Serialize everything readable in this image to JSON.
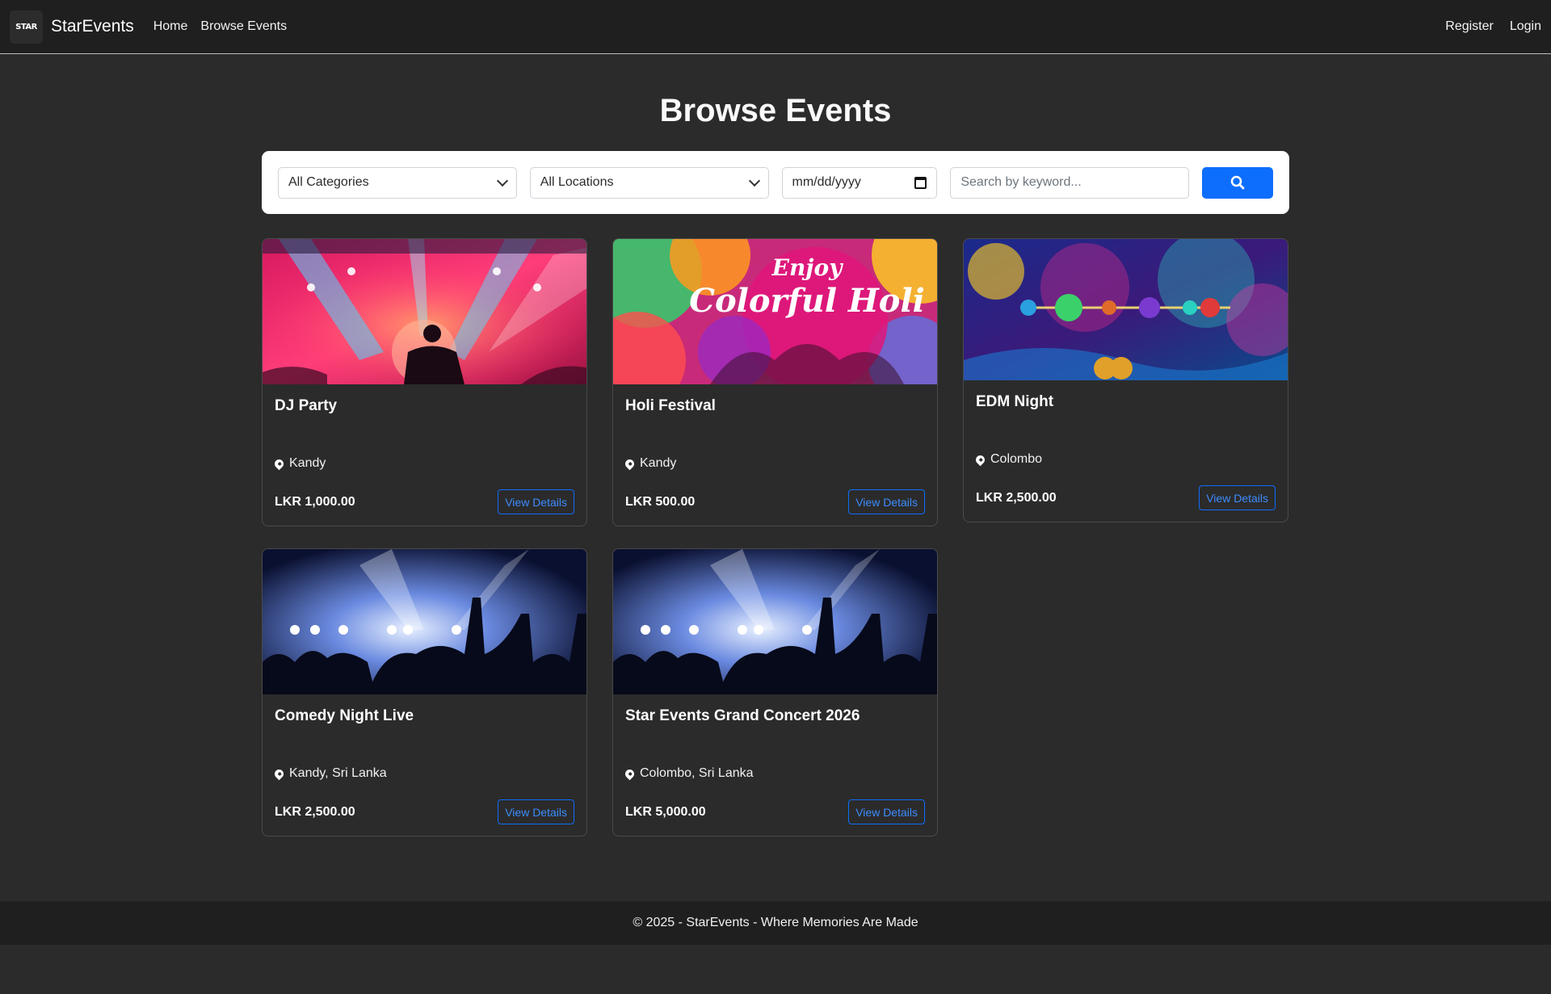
{
  "nav": {
    "brand": "StarEvents",
    "logo_text": "STAR",
    "links": [
      "Home",
      "Browse Events"
    ],
    "register": "Register",
    "login": "Login"
  },
  "page": {
    "title": "Browse Events"
  },
  "filters": {
    "category": "All Categories",
    "location": "All Locations",
    "date_placeholder": "mm/dd/yyyy",
    "search_placeholder": "Search by keyword..."
  },
  "events": [
    {
      "title": "DJ Party",
      "date": "",
      "location": "Kandy",
      "price": "LKR 1,000.00",
      "button": "View Details"
    },
    {
      "title": "Holi Festival",
      "date": "",
      "location": "Kandy",
      "price": "LKR 500.00",
      "button": "View Details",
      "image_text_1": "Enjoy",
      "image_text_2": "Colorful Holi"
    },
    {
      "title": "EDM Night",
      "date": "",
      "location": "Colombo",
      "price": "LKR 2,500.00",
      "button": "View Details"
    },
    {
      "title": "Comedy Night Live",
      "date": "",
      "location": "Kandy, Sri Lanka",
      "price": "LKR 2,500.00",
      "button": "View Details"
    },
    {
      "title": "Star Events Grand Concert 2026",
      "date": "",
      "location": "Colombo, Sri Lanka",
      "price": "LKR 5,000.00",
      "button": "View Details"
    }
  ],
  "footer": {
    "text": "© 2025 - StarEvents - Where Memories Are Made"
  },
  "colors": {
    "primary": "#0d6efd",
    "background": "#2b2b2b",
    "navbar": "#1f1f1f"
  }
}
